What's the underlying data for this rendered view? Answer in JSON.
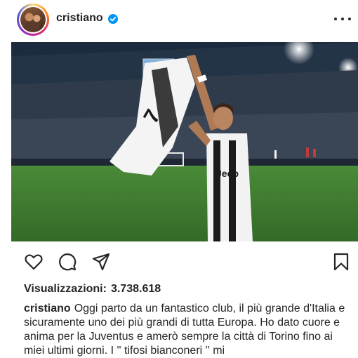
{
  "post": {
    "username": "cristiano",
    "verified": true,
    "views_label": "Visualizzazioni:",
    "views_count": "3.738.618",
    "caption": "Oggi parto da un fantastico club, il più grande d'Italia e sicuramente uno dei più grandi di tutta Europa. Ho dato cuore e anima per la Juventus e amerò sempre la città di Torino fino ai miei ultimi giorni. I '' tifosi bianconeri '' mi"
  },
  "colors": {
    "verified_blue": "#0095f6",
    "text": "#262626",
    "pitch_green": "#3e7d2e"
  },
  "icons": {
    "verified": "verified-badge-icon",
    "more": "more-options-icon",
    "like": "heart-icon",
    "comment": "comment-bubble-icon",
    "share": "paper-plane-icon",
    "save": "bookmark-icon"
  }
}
